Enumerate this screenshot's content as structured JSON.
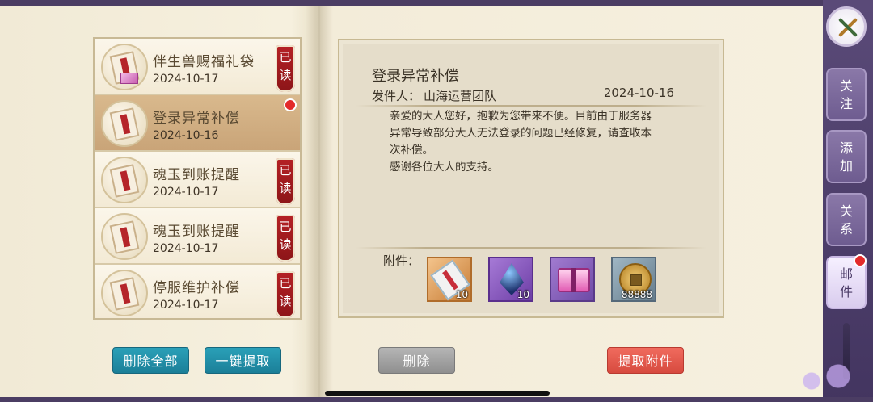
{
  "mails": [
    {
      "title": "伴生兽赐福礼袋",
      "date": "2024-10-17",
      "read_tag": "已读",
      "selected": false,
      "unread_dot": false,
      "gift_icon": true
    },
    {
      "title": "登录异常补偿",
      "date": "2024-10-16",
      "read_tag": "",
      "selected": true,
      "unread_dot": true,
      "gift_icon": false
    },
    {
      "title": "魂玉到账提醒",
      "date": "2024-10-17",
      "read_tag": "已读",
      "selected": false,
      "unread_dot": false,
      "gift_icon": false
    },
    {
      "title": "魂玉到账提醒",
      "date": "2024-10-17",
      "read_tag": "已读",
      "selected": false,
      "unread_dot": false,
      "gift_icon": false
    },
    {
      "title": "停服维护补偿",
      "date": "2024-10-17",
      "read_tag": "已读",
      "selected": false,
      "unread_dot": false,
      "gift_icon": false
    }
  ],
  "buttons": {
    "delete_all": "删除全部",
    "claim_all": "一键提取",
    "delete": "删除",
    "claim_attachments": "提取附件"
  },
  "detail": {
    "title": "登录异常补偿",
    "sender_label": "发件人：",
    "sender_name": "山海运营团队",
    "date": "2024-10-16",
    "body_line1": "亲爱的大人您好，抱歉为您带来不便。目前由于服务器",
    "body_line2": "异常导致部分大人无法登录的问题已经修复，请查收本",
    "body_line3": "次补偿。",
    "body_line4": "感谢各位大人的支持。",
    "attachments_label": "附件：",
    "attachments": [
      {
        "icon": "scroll-icon",
        "count": "10",
        "rarity_color": "#c77c35"
      },
      {
        "icon": "crystal-icon",
        "count": "10",
        "rarity_color": "#6d3ea6"
      },
      {
        "icon": "chest-icon",
        "count": "",
        "rarity_color": "#6e4aa6"
      },
      {
        "icon": "coin-icon",
        "count": "88888",
        "rarity_color": "#667d8c"
      }
    ]
  },
  "tabs": [
    {
      "label_top": "关",
      "label_bottom": "注",
      "active": false
    },
    {
      "label_top": "添",
      "label_bottom": "加",
      "active": false
    },
    {
      "label_top": "关",
      "label_bottom": "系",
      "active": false
    },
    {
      "label_top": "邮",
      "label_bottom": "件",
      "active": true,
      "badge": true
    }
  ]
}
